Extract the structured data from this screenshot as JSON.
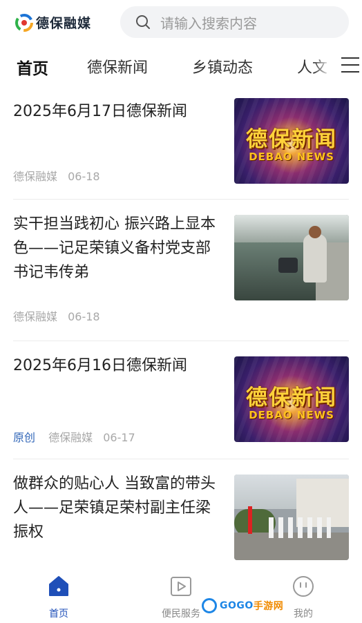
{
  "header": {
    "app_name": "德保融媒",
    "search_placeholder": "请输入搜索内容"
  },
  "tabs": [
    {
      "label": "首页",
      "active": true
    },
    {
      "label": "德保新闻",
      "active": false
    },
    {
      "label": "乡镇动态",
      "active": false
    },
    {
      "label": "人文",
      "active": false
    }
  ],
  "feed": [
    {
      "title": "2025年6月17日德保新闻",
      "badge": "",
      "source": "德保融媒",
      "date": "06-18",
      "thumb": "news-banner",
      "thumb_zh": "德保新闻",
      "thumb_en": "DEBAO NEWS"
    },
    {
      "title": "实干担当践初心 振兴路上显本色——记足荣镇义备村党支部书记韦传弟",
      "badge": "",
      "source": "德保融媒",
      "date": "06-18",
      "thumb": "fish-pond-photo"
    },
    {
      "title": "2025年6月16日德保新闻",
      "badge": "原创",
      "source": "德保融媒",
      "date": "06-17",
      "thumb": "news-banner",
      "thumb_zh": "德保新闻",
      "thumb_en": "DEBAO NEWS"
    },
    {
      "title": "做群众的贴心人 当致富的带头人——足荣镇足荣村副主任梁振权",
      "badge": "",
      "source": "",
      "date": "",
      "thumb": "village-photo"
    }
  ],
  "bottom_nav": [
    {
      "label": "首页",
      "icon": "home-icon",
      "active": true
    },
    {
      "label": "便民服务",
      "icon": "play-icon",
      "active": false
    },
    {
      "label": "我的",
      "icon": "smile-icon",
      "active": false
    }
  ],
  "watermark": {
    "text_en": "GOGO",
    "text_cn": "手游网"
  },
  "colors": {
    "accent": "#1f4fb8",
    "badge_original": "#3166b8",
    "meta_gray": "#a8a8a8"
  }
}
